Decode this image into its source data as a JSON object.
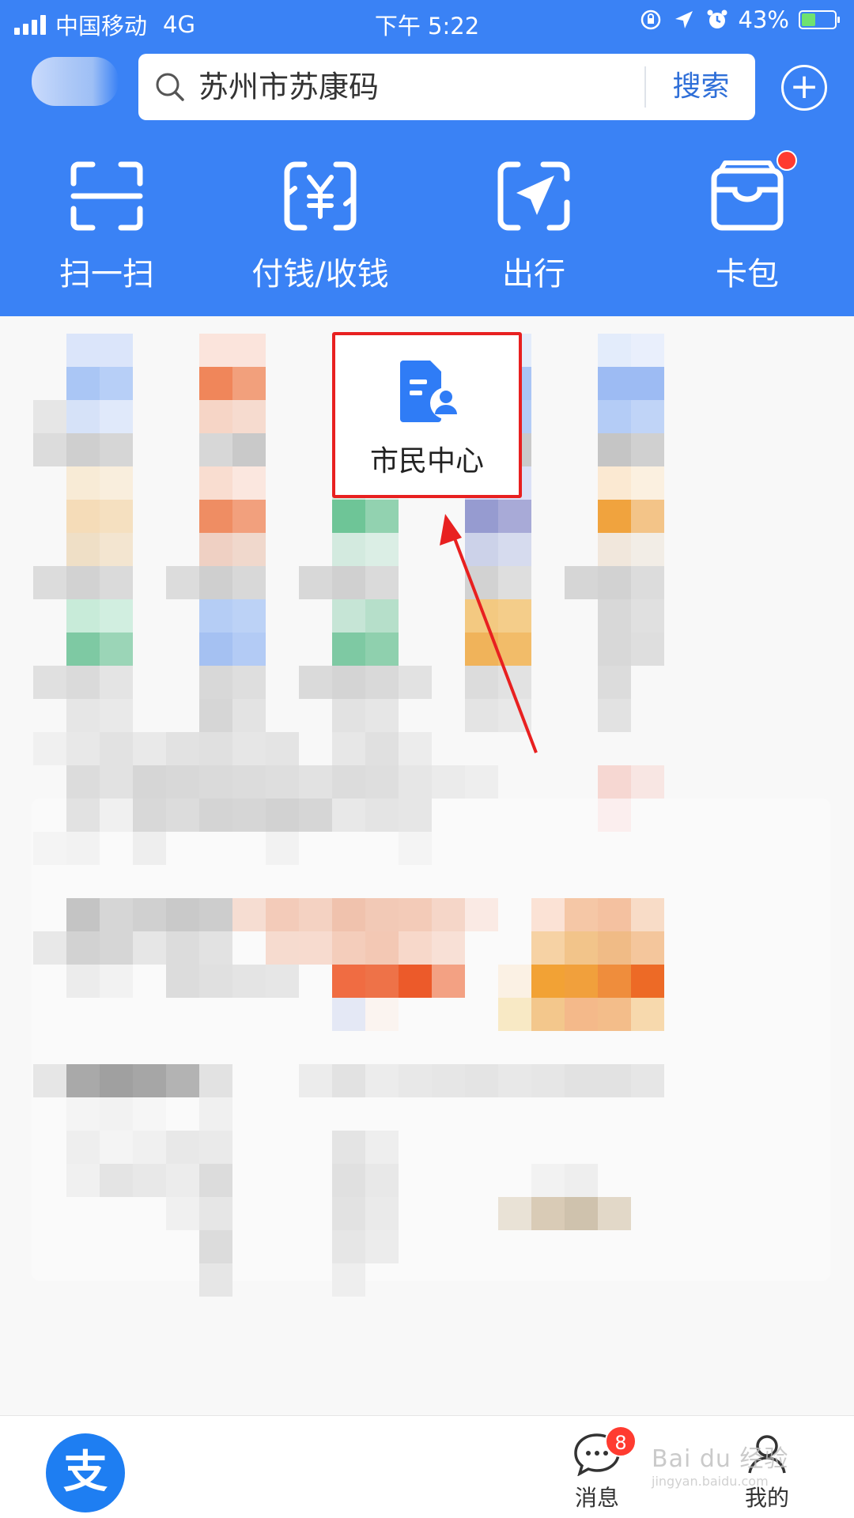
{
  "status_bar": {
    "carrier": "中国移动",
    "network": "4G",
    "time": "下午 5:22",
    "battery": "43%",
    "battery_level": 0.43
  },
  "search": {
    "placeholder": "苏州市苏康码",
    "button_label": "搜索"
  },
  "quick_actions": [
    {
      "label": "扫一扫",
      "icon": "scan-icon"
    },
    {
      "label": "付钱/收钱",
      "icon": "pay-icon"
    },
    {
      "label": "出行",
      "icon": "travel-icon"
    },
    {
      "label": "卡包",
      "icon": "card-wallet-icon"
    }
  ],
  "highlighted_app": {
    "label": "市民中心",
    "icon": "citizen-center-icon"
  },
  "tab_bar": {
    "home_icon_char": "支",
    "messages_label": "消息",
    "messages_badge": "8",
    "mine_label": "我的"
  },
  "watermark": {
    "brand": "Bai du 经验",
    "url": "jingyan.baidu.com"
  },
  "colors": {
    "header_blue": "#3a82f5",
    "highlight_red": "#e82020",
    "badge_red": "#ff3b30",
    "alipay_blue": "#1e7ef2"
  }
}
